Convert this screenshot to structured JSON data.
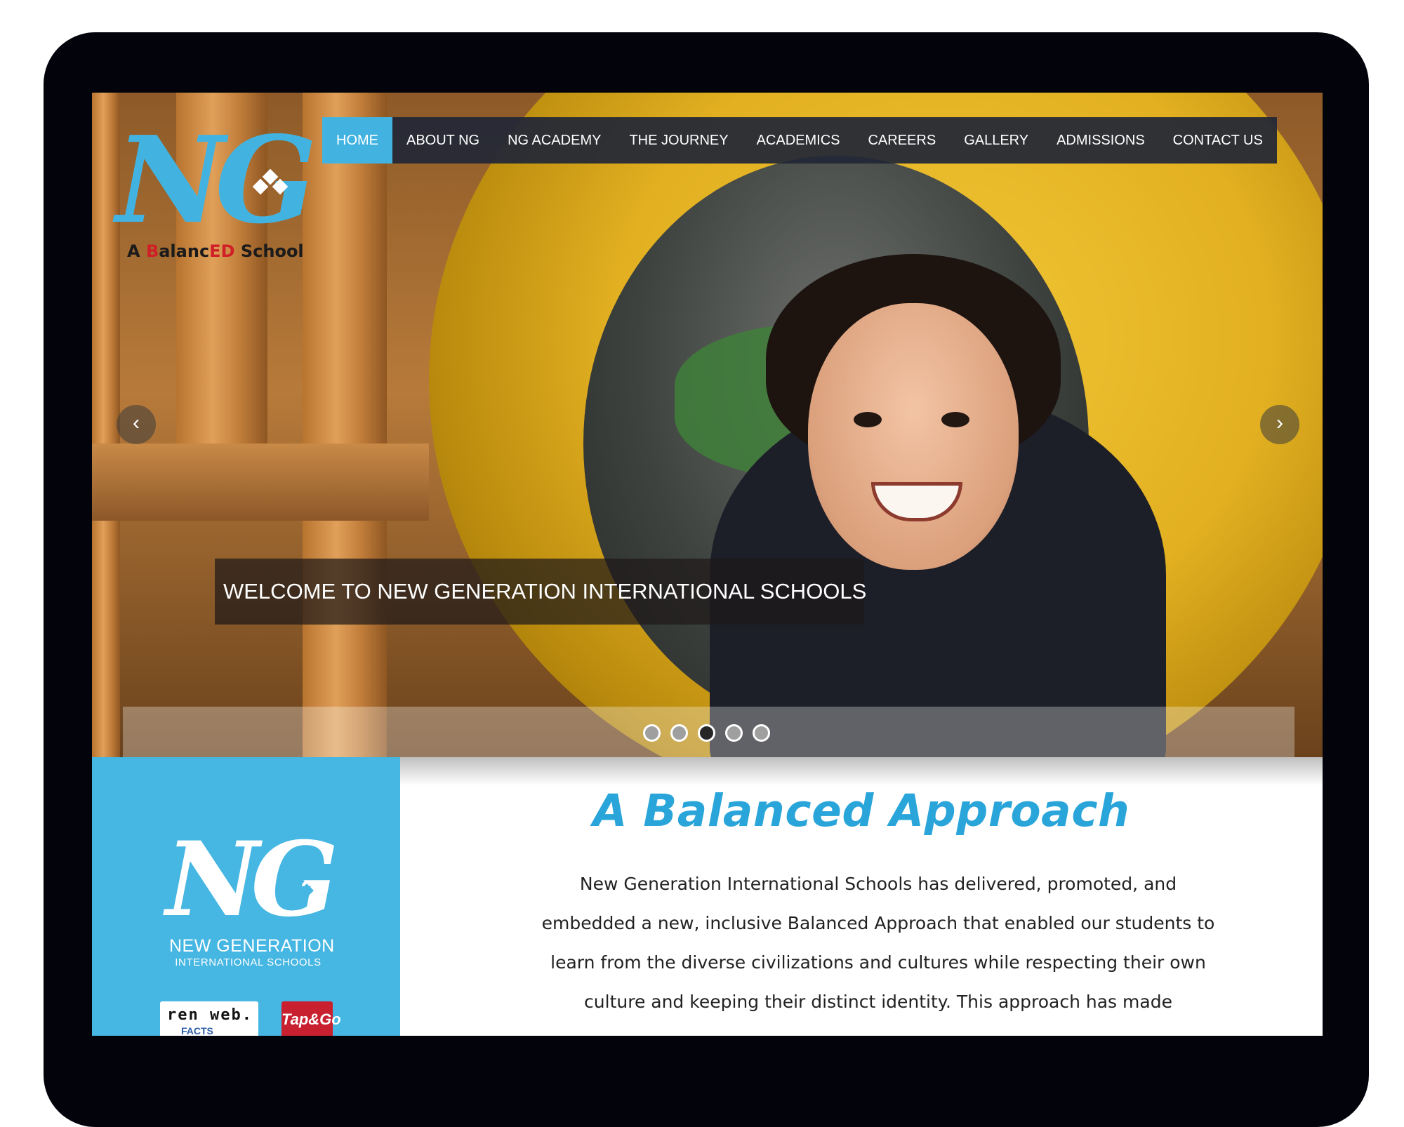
{
  "brand": {
    "logo_letters": "NG",
    "tagline_a": "A ",
    "tagline_b": "B",
    "tagline_alanc": "alanc",
    "tagline_ed": "ED",
    "tagline_school": " School",
    "primary_color": "#42b3e1",
    "accent_red": "#d01f26"
  },
  "nav": {
    "items": [
      {
        "label": "HOME",
        "active": true
      },
      {
        "label": "ABOUT NG"
      },
      {
        "label": "NG ACADEMY"
      },
      {
        "label": "THE JOURNEY"
      },
      {
        "label": "ACADEMICS"
      },
      {
        "label": "CAREERS"
      },
      {
        "label": "GALLERY"
      },
      {
        "label": "ADMISSIONS"
      },
      {
        "label": "CONTACT US"
      }
    ]
  },
  "slider": {
    "caption": "WELCOME TO NEW GENERATION INTERNATIONAL SCHOOLS",
    "prev_icon": "‹",
    "next_icon": "›",
    "slide_count": 5,
    "active_index": 3
  },
  "sidebar": {
    "logo_letters": "NG",
    "school_name_line1": "NEW GENERATION",
    "school_name_line2": "INTERNATIONAL SCHOOLS",
    "badge1_text": "ren web.",
    "badge1_sub": "FACTS",
    "badge2_text": "Tap&Go"
  },
  "main": {
    "title": "A Balanced Approach",
    "body": "New Generation International Schools has delivered, promoted, and embedded a new, inclusive Balanced Approach that enabled our students to learn from the diverse civilizations and cultures while respecting their own culture and keeping their distinct identity. This approach has made"
  }
}
